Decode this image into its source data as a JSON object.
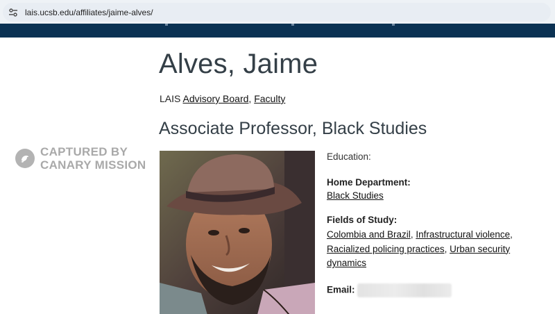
{
  "browser": {
    "url": "lais.ucsb.edu/affiliates/jaime-alves/"
  },
  "profile": {
    "name": "Alves, Jaime",
    "affiliation_prefix": "LAIS",
    "affiliation_links": [
      "Advisory Board",
      "Faculty"
    ],
    "separator": ",",
    "position": "Associate Professor, Black Studies",
    "education_label": "Education:",
    "home_department_label": "Home Department:",
    "home_department": "Black Studies",
    "fields_label": "Fields of Study:",
    "fields": [
      "Colombia and Brazil",
      "Infrastructural violence",
      "Racialized policing practices",
      "Urban security dynamics"
    ],
    "email_label": "Email:"
  },
  "watermark": {
    "line1": "CAPTURED BY",
    "line2": "CANARY MISSION",
    "logo_icon": "canary-bird-icon"
  },
  "colors": {
    "nav_bar": "#0b3253",
    "heading": "#343f47",
    "watermark": "#a9a9a9"
  }
}
